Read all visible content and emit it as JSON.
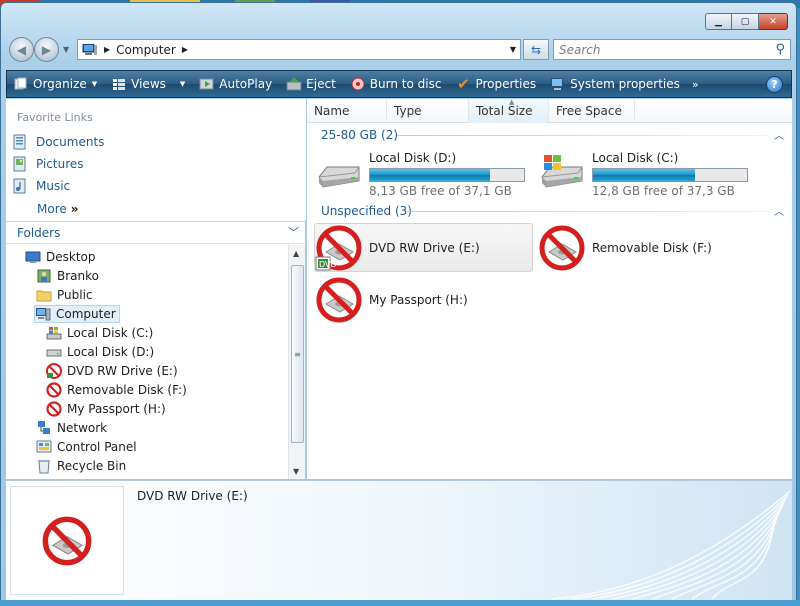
{
  "window": {
    "title_buttons": [
      "minimize",
      "maximize",
      "close"
    ]
  },
  "address": {
    "icon": "computer-icon",
    "path": "Computer",
    "search_placeholder": "Search"
  },
  "toolbar": {
    "organize": "Organize",
    "views": "Views",
    "autoplay": "AutoPlay",
    "eject": "Eject",
    "burn": "Burn to disc",
    "properties": "Properties",
    "system_properties": "System properties",
    "more": "»",
    "help": "?"
  },
  "favorites": {
    "title": "Favorite Links",
    "items": [
      {
        "label": "Documents",
        "icon": "documents-icon"
      },
      {
        "label": "Pictures",
        "icon": "pictures-icon"
      },
      {
        "label": "Music",
        "icon": "music-icon"
      }
    ],
    "more": "More",
    "more_chevrons": "»"
  },
  "folders": {
    "title": "Folders",
    "tree": [
      {
        "label": "Desktop",
        "icon": "desktop-icon"
      },
      {
        "label": "Branko",
        "icon": "user-folder-icon"
      },
      {
        "label": "Public",
        "icon": "folder-icon"
      },
      {
        "label": "Computer",
        "icon": "computer-icon",
        "selected": true
      },
      {
        "label": "Local Disk (C:)",
        "icon": "windows-drive-icon"
      },
      {
        "label": "Local Disk (D:)",
        "icon": "drive-icon"
      },
      {
        "label": "DVD RW Drive (E:)",
        "icon": "dvd-drive-icon"
      },
      {
        "label": "Removable Disk (F:)",
        "icon": "no-entry-icon"
      },
      {
        "label": "My Passport (H:)",
        "icon": "no-entry-icon"
      },
      {
        "label": "Network",
        "icon": "network-icon"
      },
      {
        "label": "Control Panel",
        "icon": "control-panel-icon"
      },
      {
        "label": "Recycle Bin",
        "icon": "recycle-bin-icon"
      }
    ]
  },
  "columns": [
    "Name",
    "Type",
    "Total Size",
    "Free Space"
  ],
  "groups": [
    {
      "label": "25-80 GB (2)",
      "disks": [
        {
          "name": "Local Disk (D:)",
          "free_text": "8,13 GB free of 37,1 GB",
          "used_fraction": 0.78,
          "icon": "drive-icon"
        },
        {
          "name": "Local Disk (C:)",
          "free_text": "12,8 GB free of 37,3 GB",
          "used_fraction": 0.66,
          "icon": "windows-drive-icon"
        }
      ]
    },
    {
      "label": "Unspecified (3)",
      "devices": [
        {
          "name": "DVD RW Drive (E:)",
          "icon": "dvd-drive-icon",
          "selected": true
        },
        {
          "name": "Removable Disk (F:)",
          "icon": "no-entry-icon"
        },
        {
          "name": "My Passport (H:)",
          "icon": "no-entry-icon"
        }
      ]
    }
  ],
  "details": {
    "name": "DVD RW Drive (E:)",
    "icon": "no-entry-drive-icon"
  },
  "colors": {
    "accent": "#1f5a97",
    "cmdbar": "#2c5c82",
    "selection": "#e2eef9",
    "progress": "#1891c6",
    "no_entry": "#d3201f"
  }
}
